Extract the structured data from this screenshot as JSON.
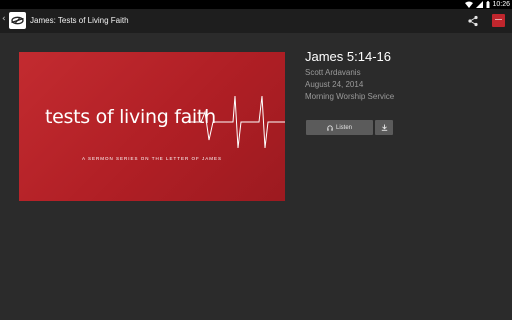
{
  "status_bar": {
    "time": "10:26",
    "icons": [
      "wifi-icon",
      "signal-icon",
      "battery-icon"
    ]
  },
  "action_bar": {
    "back_glyph": "‹",
    "title": "James: Tests of Living Faith",
    "app_icon": "church-logo-icon",
    "share_icon": "share-icon"
  },
  "artwork": {
    "series_title": "tests of living faith",
    "series_subtitle": "A SERMON SERIES ON THE LETTER OF JAMES",
    "background_color": "#b72329"
  },
  "sermon": {
    "title": "James 5:14-16",
    "speaker": "Scott Ardavanis",
    "date": "August 24, 2014",
    "service": "Morning Worship Service"
  },
  "actions": {
    "listen_label": "Listen",
    "listen_icon": "headphones-icon",
    "download_icon": "download-icon"
  },
  "colors": {
    "background": "#2b2b2b",
    "action_bar": "#1e1e1e",
    "button": "#5b5b5b",
    "accent_red": "#c0262d"
  }
}
